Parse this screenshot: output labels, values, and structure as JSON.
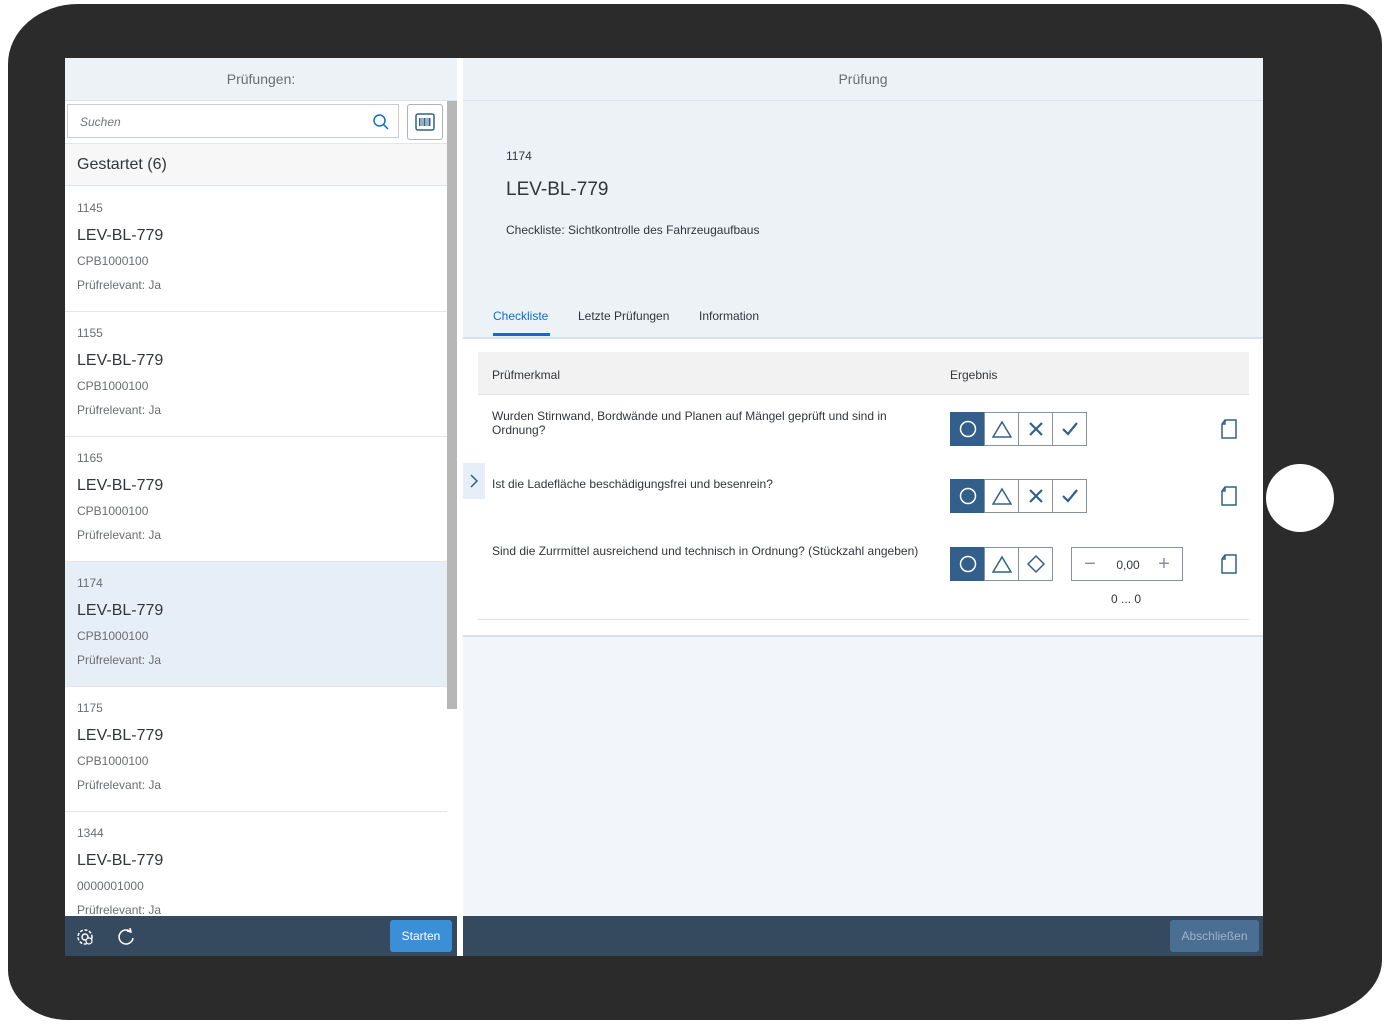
{
  "master": {
    "header_title": "Prüfungen:",
    "search_placeholder": "Suchen",
    "group_header": "Gestartet (6)",
    "items": [
      {
        "number": "1145",
        "title": "LEV-BL-779",
        "code": "CPB1000100",
        "relevant": "Prüfrelevant: Ja",
        "selected": false
      },
      {
        "number": "1155",
        "title": "LEV-BL-779",
        "code": "CPB1000100",
        "relevant": "Prüfrelevant: Ja",
        "selected": false
      },
      {
        "number": "1165",
        "title": "LEV-BL-779",
        "code": "CPB1000100",
        "relevant": "Prüfrelevant: Ja",
        "selected": false
      },
      {
        "number": "1174",
        "title": "LEV-BL-779",
        "code": "CPB1000100",
        "relevant": "Prüfrelevant: Ja",
        "selected": true
      },
      {
        "number": "1175",
        "title": "LEV-BL-779",
        "code": "CPB1000100",
        "relevant": "Prüfrelevant: Ja",
        "selected": false
      },
      {
        "number": "1344",
        "title": "LEV-BL-779",
        "code": "0000001000",
        "relevant": "Prüfrelevant: Ja",
        "selected": false
      }
    ],
    "footer": {
      "settings_icon": "settings-gear-icon",
      "refresh_icon": "refresh-icon",
      "start_label": "Starten"
    }
  },
  "detail": {
    "header_title": "Prüfung",
    "object": {
      "number": "1174",
      "title": "LEV-BL-779",
      "subtitle": "Checkliste: Sichtkontrolle des Fahrzeugaufbaus"
    },
    "tabs": [
      {
        "label": "Checkliste",
        "active": true
      },
      {
        "label": "Letzte Prüfungen",
        "active": false
      },
      {
        "label": "Information",
        "active": false
      }
    ],
    "table": {
      "col_feature": "Prüfmerkmal",
      "col_result": "Ergebnis",
      "rows": [
        {
          "text": "Wurden Stirnwand, Bordwände und Planen auf Mängel geprüft und sind in Ordnung?",
          "options": [
            "circle",
            "triangle",
            "cross",
            "check"
          ],
          "selected": 0
        },
        {
          "text": "Ist die Ladefläche beschädigungsfrei und besenrein?",
          "options": [
            "circle",
            "triangle",
            "cross",
            "check"
          ],
          "selected": 0
        },
        {
          "text": "Sind die Zurrmittel ausreichend und technisch in Ordnung? (Stückzahl angeben)",
          "options": [
            "circle",
            "triangle",
            "diamond"
          ],
          "selected": 0,
          "stepper_value": "0,00",
          "range": "0 ... 0"
        }
      ]
    },
    "footer": {
      "finish_label": "Abschließen"
    },
    "colors": {
      "accent": "#0a6ed1",
      "shell": "#354a5f",
      "selected_option": "#33608a"
    }
  }
}
